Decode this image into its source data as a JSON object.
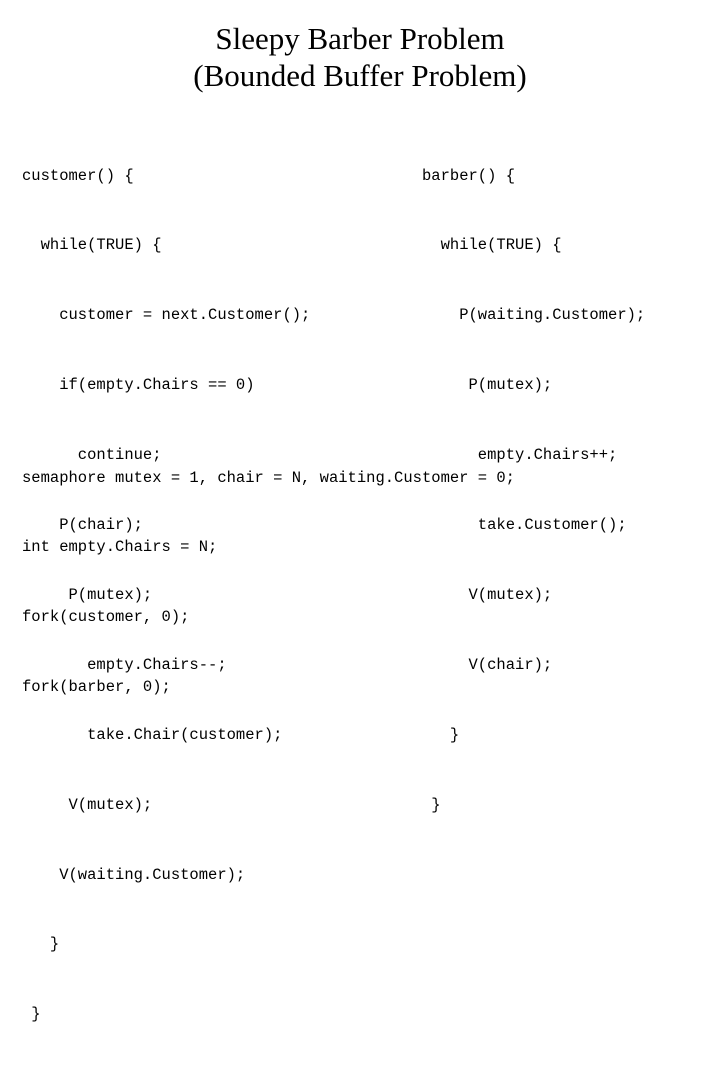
{
  "slide": {
    "title_lines": [
      "Sleepy Barber Problem",
      "(Bounded Buffer Problem)"
    ],
    "left_code": [
      "customer() {",
      "  while(TRUE) {",
      "    customer = next.Customer();",
      "    if(empty.Chairs == 0)",
      "      continue;",
      "    P(chair);",
      "     P(mutex);",
      "       empty.Chairs--;",
      "       take.Chair(customer);",
      "     V(mutex);",
      "    V(waiting.Customer);",
      "   }",
      " }"
    ],
    "right_code": [
      "barber() {",
      "  while(TRUE) {",
      "    P(waiting.Customer);",
      "     P(mutex);",
      "      empty.Chairs++;",
      "      take.Customer();",
      "     V(mutex);",
      "     V(chair);",
      "   }",
      " }"
    ],
    "footer_code": [
      "semaphore mutex = 1, chair = N, waiting.Customer = 0;",
      "int empty.Chairs = N;",
      "fork(customer, 0);",
      "fork(barber, 0);"
    ]
  }
}
